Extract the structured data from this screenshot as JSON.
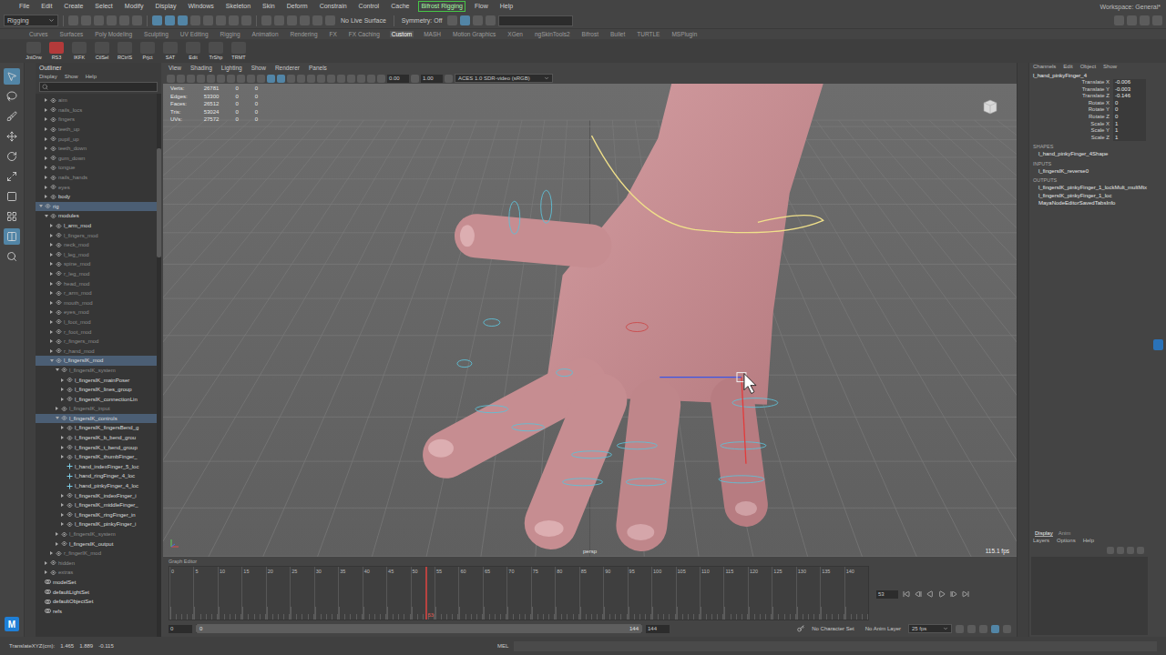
{
  "menu_bar": {
    "items": [
      {
        "label": "File",
        "highlighted": false
      },
      {
        "label": "Edit",
        "highlighted": false
      },
      {
        "label": "Create",
        "highlighted": false
      },
      {
        "label": "Select",
        "highlighted": false
      },
      {
        "label": "Modify",
        "highlighted": false
      },
      {
        "label": "Display",
        "highlighted": false
      },
      {
        "label": "Windows",
        "highlighted": false
      },
      {
        "label": "Skeleton",
        "highlighted": false
      },
      {
        "label": "Skin",
        "highlighted": false
      },
      {
        "label": "Deform",
        "highlighted": false
      },
      {
        "label": "Constrain",
        "highlighted": false
      },
      {
        "label": "Control",
        "highlighted": false
      },
      {
        "label": "Cache",
        "highlighted": false
      },
      {
        "label": "Bifrost Rigging",
        "highlighted": true
      },
      {
        "label": "Flow",
        "highlighted": false
      },
      {
        "label": "Help",
        "highlighted": false
      }
    ],
    "workspace": "Workspace: General*"
  },
  "status_line": {
    "mode": "Rigging",
    "live_surface": "No Live Surface",
    "symmetry": "Symmetry: Off"
  },
  "shelf_tabs": [
    {
      "label": "Curves",
      "selected": false
    },
    {
      "label": "Surfaces",
      "selected": false
    },
    {
      "label": "Poly Modeling",
      "selected": false
    },
    {
      "label": "Sculpting",
      "selected": false
    },
    {
      "label": "UV Editing",
      "selected": false
    },
    {
      "label": "Rigging",
      "selected": false
    },
    {
      "label": "Animation",
      "selected": false
    },
    {
      "label": "Rendering",
      "selected": false
    },
    {
      "label": "FX",
      "selected": false
    },
    {
      "label": "FX Caching",
      "selected": false
    },
    {
      "label": "Custom",
      "selected": true
    },
    {
      "label": "MASH",
      "selected": false
    },
    {
      "label": "Motion Graphics",
      "selected": false
    },
    {
      "label": "XGen",
      "selected": false
    },
    {
      "label": "ngSkinTools2",
      "selected": false
    },
    {
      "label": "Bifrost",
      "selected": false
    },
    {
      "label": "Bullet",
      "selected": false
    },
    {
      "label": "TURTLE",
      "selected": false
    },
    {
      "label": "MSPlugin",
      "selected": false
    }
  ],
  "shelf_buttons": [
    {
      "label": "JntOrw",
      "color": "#4d4d4d"
    },
    {
      "label": "RS3",
      "color": "#b33a3a"
    },
    {
      "label": "IKFK",
      "color": "#4d4d4d"
    },
    {
      "label": "CtlSel",
      "color": "#4d4d4d"
    },
    {
      "label": "RCtrlS",
      "color": "#4d4d4d"
    },
    {
      "label": "Prjct",
      "color": "#4d4d4d"
    },
    {
      "label": "SAT",
      "color": "#4d4d4d"
    },
    {
      "label": "Edit",
      "color": "#4d4d4d"
    },
    {
      "label": "TrShp",
      "color": "#4d4d4d"
    },
    {
      "label": "TRMT",
      "color": "#4d4d4d"
    }
  ],
  "toolbox": {
    "logo": "M"
  },
  "outliner": {
    "title": "Outliner",
    "menu": [
      "Display",
      "Show",
      "Help"
    ],
    "items": [
      {
        "name": "aim",
        "depth": 1,
        "kind": "group",
        "has_children": true,
        "expanded": false,
        "hidden": true,
        "selected": false
      },
      {
        "name": "nails_locs",
        "depth": 1,
        "kind": "group",
        "has_children": true,
        "expanded": false,
        "hidden": true,
        "selected": false
      },
      {
        "name": "fingers",
        "depth": 1,
        "kind": "group",
        "has_children": true,
        "expanded": false,
        "hidden": true,
        "selected": false
      },
      {
        "name": "teeth_up",
        "depth": 1,
        "kind": "group",
        "has_children": true,
        "expanded": false,
        "hidden": true,
        "selected": false
      },
      {
        "name": "pupil_up",
        "depth": 1,
        "kind": "group",
        "has_children": true,
        "expanded": false,
        "hidden": true,
        "selected": false
      },
      {
        "name": "teeth_down",
        "depth": 1,
        "kind": "group",
        "has_children": true,
        "expanded": false,
        "hidden": true,
        "selected": false
      },
      {
        "name": "gum_down",
        "depth": 1,
        "kind": "group",
        "has_children": true,
        "expanded": false,
        "hidden": true,
        "selected": false
      },
      {
        "name": "tongue",
        "depth": 1,
        "kind": "group",
        "has_children": true,
        "expanded": false,
        "hidden": true,
        "selected": false
      },
      {
        "name": "nails_hands",
        "depth": 1,
        "kind": "group",
        "has_children": true,
        "expanded": false,
        "hidden": true,
        "selected": false
      },
      {
        "name": "eyes",
        "depth": 1,
        "kind": "group",
        "has_children": true,
        "expanded": false,
        "hidden": true,
        "selected": false
      },
      {
        "name": "body",
        "depth": 1,
        "kind": "group",
        "has_children": true,
        "expanded": false,
        "hidden": false,
        "selected": false
      },
      {
        "name": "rig",
        "depth": 0,
        "kind": "group",
        "has_children": true,
        "expanded": true,
        "hidden": false,
        "selected": true
      },
      {
        "name": "modules",
        "depth": 1,
        "kind": "group",
        "has_children": true,
        "expanded": true,
        "hidden": false,
        "selected": false
      },
      {
        "name": "l_arm_mod",
        "depth": 2,
        "kind": "group",
        "has_children": true,
        "expanded": false,
        "hidden": false,
        "selected": false
      },
      {
        "name": "l_fingers_mod",
        "depth": 2,
        "kind": "group",
        "has_children": true,
        "expanded": false,
        "hidden": true,
        "selected": false
      },
      {
        "name": "neck_mod",
        "depth": 2,
        "kind": "group",
        "has_children": true,
        "expanded": false,
        "hidden": true,
        "selected": false
      },
      {
        "name": "l_leg_mod",
        "depth": 2,
        "kind": "group",
        "has_children": true,
        "expanded": false,
        "hidden": true,
        "selected": false
      },
      {
        "name": "spine_mod",
        "depth": 2,
        "kind": "group",
        "has_children": true,
        "expanded": false,
        "hidden": true,
        "selected": false
      },
      {
        "name": "r_leg_mod",
        "depth": 2,
        "kind": "group",
        "has_children": true,
        "expanded": false,
        "hidden": true,
        "selected": false
      },
      {
        "name": "head_mod",
        "depth": 2,
        "kind": "group",
        "has_children": true,
        "expanded": false,
        "hidden": true,
        "selected": false
      },
      {
        "name": "r_arm_mod",
        "depth": 2,
        "kind": "group",
        "has_children": true,
        "expanded": false,
        "hidden": true,
        "selected": false
      },
      {
        "name": "mouth_mod",
        "depth": 2,
        "kind": "group",
        "has_children": true,
        "expanded": false,
        "hidden": true,
        "selected": false
      },
      {
        "name": "eyes_mod",
        "depth": 2,
        "kind": "group",
        "has_children": true,
        "expanded": false,
        "hidden": true,
        "selected": false
      },
      {
        "name": "l_foot_mod",
        "depth": 2,
        "kind": "group",
        "has_children": true,
        "expanded": false,
        "hidden": true,
        "selected": false
      },
      {
        "name": "r_foot_mod",
        "depth": 2,
        "kind": "group",
        "has_children": true,
        "expanded": false,
        "hidden": true,
        "selected": false
      },
      {
        "name": "r_fingers_mod",
        "depth": 2,
        "kind": "group",
        "has_children": true,
        "expanded": false,
        "hidden": true,
        "selected": false
      },
      {
        "name": "r_hand_mod",
        "depth": 2,
        "kind": "group",
        "has_children": true,
        "expanded": false,
        "hidden": true,
        "selected": false
      },
      {
        "name": "l_fingersIK_mod",
        "depth": 2,
        "kind": "group",
        "has_children": true,
        "expanded": true,
        "hidden": false,
        "selected": true
      },
      {
        "name": "l_fingersIK_system",
        "depth": 3,
        "kind": "group",
        "has_children": true,
        "expanded": true,
        "hidden": true,
        "selected": false
      },
      {
        "name": "l_fingersIK_mainPoser",
        "depth": 4,
        "kind": "group",
        "has_children": true,
        "expanded": false,
        "hidden": false,
        "selected": false
      },
      {
        "name": "l_fingersIK_lines_group",
        "depth": 4,
        "kind": "group",
        "has_children": true,
        "expanded": false,
        "hidden": false,
        "selected": false
      },
      {
        "name": "l_fingersIK_connectionLin",
        "depth": 4,
        "kind": "group",
        "has_children": true,
        "expanded": false,
        "hidden": false,
        "selected": false
      },
      {
        "name": "l_fingersIK_input",
        "depth": 3,
        "kind": "group",
        "has_children": true,
        "expanded": false,
        "hidden": true,
        "selected": false
      },
      {
        "name": "l_fingersIK_controls",
        "depth": 3,
        "kind": "group",
        "has_children": true,
        "expanded": true,
        "hidden": false,
        "selected": true
      },
      {
        "name": "l_fingersIK_fingersBend_g",
        "depth": 4,
        "kind": "group",
        "has_children": true,
        "expanded": false,
        "hidden": false,
        "selected": false
      },
      {
        "name": "l_fingersIK_b_bend_grou",
        "depth": 4,
        "kind": "group",
        "has_children": true,
        "expanded": false,
        "hidden": false,
        "selected": false
      },
      {
        "name": "l_fingersIK_t_bend_group",
        "depth": 4,
        "kind": "group",
        "has_children": true,
        "expanded": false,
        "hidden": false,
        "selected": false
      },
      {
        "name": "l_fingersIK_thumbFinger_",
        "depth": 4,
        "kind": "group",
        "has_children": true,
        "expanded": false,
        "hidden": false,
        "selected": false
      },
      {
        "name": "l_hand_indexFinger_5_loc",
        "depth": 4,
        "kind": "locator",
        "has_children": false,
        "expanded": false,
        "hidden": false,
        "selected": false
      },
      {
        "name": "l_hand_ringFinger_4_loc",
        "depth": 4,
        "kind": "locator",
        "has_children": false,
        "expanded": false,
        "hidden": false,
        "selected": false
      },
      {
        "name": "l_hand_pinkyFinger_4_loc",
        "depth": 4,
        "kind": "locator",
        "has_children": false,
        "expanded": false,
        "hidden": false,
        "selected": false
      },
      {
        "name": "l_fingersIK_indexFinger_i",
        "depth": 4,
        "kind": "group",
        "has_children": true,
        "expanded": false,
        "hidden": false,
        "selected": false
      },
      {
        "name": "l_fingersIK_middleFinger_",
        "depth": 4,
        "kind": "group",
        "has_children": true,
        "expanded": false,
        "hidden": false,
        "selected": false
      },
      {
        "name": "l_fingersIK_ringFinger_in",
        "depth": 4,
        "kind": "group",
        "has_children": true,
        "expanded": false,
        "hidden": false,
        "selected": false
      },
      {
        "name": "l_fingersIK_pinkyFinger_i",
        "depth": 4,
        "kind": "group",
        "has_children": true,
        "expanded": false,
        "hidden": false,
        "selected": false
      },
      {
        "name": "l_fingersIK_system",
        "depth": 3,
        "kind": "group",
        "has_children": true,
        "expanded": false,
        "hidden": true,
        "selected": false
      },
      {
        "name": "l_fingersIK_output",
        "depth": 3,
        "kind": "group",
        "has_children": true,
        "expanded": false,
        "hidden": false,
        "selected": false
      },
      {
        "name": "r_fingerIK_mod",
        "depth": 2,
        "kind": "group",
        "has_children": true,
        "expanded": false,
        "hidden": true,
        "selected": false
      },
      {
        "name": "hidden",
        "depth": 1,
        "kind": "group",
        "has_children": true,
        "expanded": false,
        "hidden": true,
        "selected": false
      },
      {
        "name": "extras",
        "depth": 1,
        "kind": "group",
        "has_children": true,
        "expanded": false,
        "hidden": true,
        "selected": false
      },
      {
        "name": "modelSet",
        "depth": 0,
        "kind": "set",
        "has_children": false,
        "expanded": false,
        "hidden": false,
        "selected": false
      },
      {
        "name": "defaultLightSet",
        "depth": 0,
        "kind": "set",
        "has_children": false,
        "expanded": false,
        "hidden": false,
        "selected": false
      },
      {
        "name": "defaultObjectSet",
        "depth": 0,
        "kind": "set",
        "has_children": false,
        "expanded": false,
        "hidden": false,
        "selected": false
      },
      {
        "name": "refs",
        "depth": 0,
        "kind": "set",
        "has_children": false,
        "expanded": false,
        "hidden": false,
        "selected": false
      }
    ]
  },
  "viewport": {
    "menu": [
      "View",
      "Shading",
      "Lighting",
      "Show",
      "Renderer",
      "Panels"
    ],
    "exposure": "0.00",
    "gamma": "1.00",
    "color_space": "ACES 1.0 SDR-video (sRGB)",
    "hud": [
      {
        "label": "Verts:",
        "values": [
          "26781",
          "0",
          "0"
        ]
      },
      {
        "label": "Edges:",
        "values": [
          "53300",
          "0",
          "0"
        ]
      },
      {
        "label": "Faces:",
        "values": [
          "26512",
          "0",
          "0"
        ]
      },
      {
        "label": "Tris:",
        "values": [
          "53024",
          "0",
          "0"
        ]
      },
      {
        "label": "UVs:",
        "values": [
          "27572",
          "0",
          "0"
        ]
      }
    ],
    "camera": "persp",
    "fps": "115.1 fps"
  },
  "time_slider": {
    "title": "Graph Editor",
    "ticks": [
      "0",
      "5",
      "10",
      "15",
      "20",
      "25",
      "30",
      "35",
      "40",
      "45",
      "50",
      "55",
      "60",
      "65",
      "70",
      "75",
      "80",
      "85",
      "90",
      "95",
      "100",
      "105",
      "110",
      "115",
      "120",
      "125",
      "130",
      "135",
      "140"
    ],
    "current_frame": "53",
    "level": 0.366
  },
  "range_slider": {
    "start": "0",
    "inner_start": "0",
    "inner_end": "144",
    "end": "144",
    "level": 1,
    "character_set": "No Character Set",
    "anim_layer": "No Anim Layer",
    "fps": "25 fps"
  },
  "channel_box": {
    "menu": [
      "Channels",
      "Edit",
      "Object",
      "Show"
    ],
    "node": "l_hand_pinkyFinger_4",
    "attributes": [
      {
        "name": "Translate X",
        "value": "-0.006"
      },
      {
        "name": "Translate Y",
        "value": "-0.003"
      },
      {
        "name": "Translate Z",
        "value": "-0.146"
      },
      {
        "name": "Rotate X",
        "value": "0"
      },
      {
        "name": "Rotate Y",
        "value": "0"
      },
      {
        "name": "Rotate Z",
        "value": "0"
      },
      {
        "name": "Scale X",
        "value": "1"
      },
      {
        "name": "Scale Y",
        "value": "1"
      },
      {
        "name": "Scale Z",
        "value": "1"
      }
    ],
    "sections": [
      {
        "title": "SHAPES",
        "items": [
          "l_hand_pinkyFinger_4Shape"
        ]
      },
      {
        "title": "INPUTS",
        "items": [
          "l_fingersIK_reverse0"
        ]
      },
      {
        "title": "OUTPUTS",
        "items": [
          "l_fingersIK_pinkyFinger_1_lockMult_multMtx",
          "l_fingersIK_pinkyFinger_1_loc",
          "MayaNodeEditorSavedTabsInfo"
        ]
      }
    ]
  },
  "layer_editor": {
    "tabs": [
      {
        "label": "Display",
        "selected": true
      },
      {
        "label": "Anim",
        "selected": false
      }
    ],
    "menu": [
      "Layers",
      "Options",
      "Help"
    ]
  },
  "bottom_bar": {
    "label": "TranslateXYZ(cm):",
    "values": [
      "1.465",
      "1.889",
      "-0.115"
    ],
    "command_mode": "MEL"
  }
}
